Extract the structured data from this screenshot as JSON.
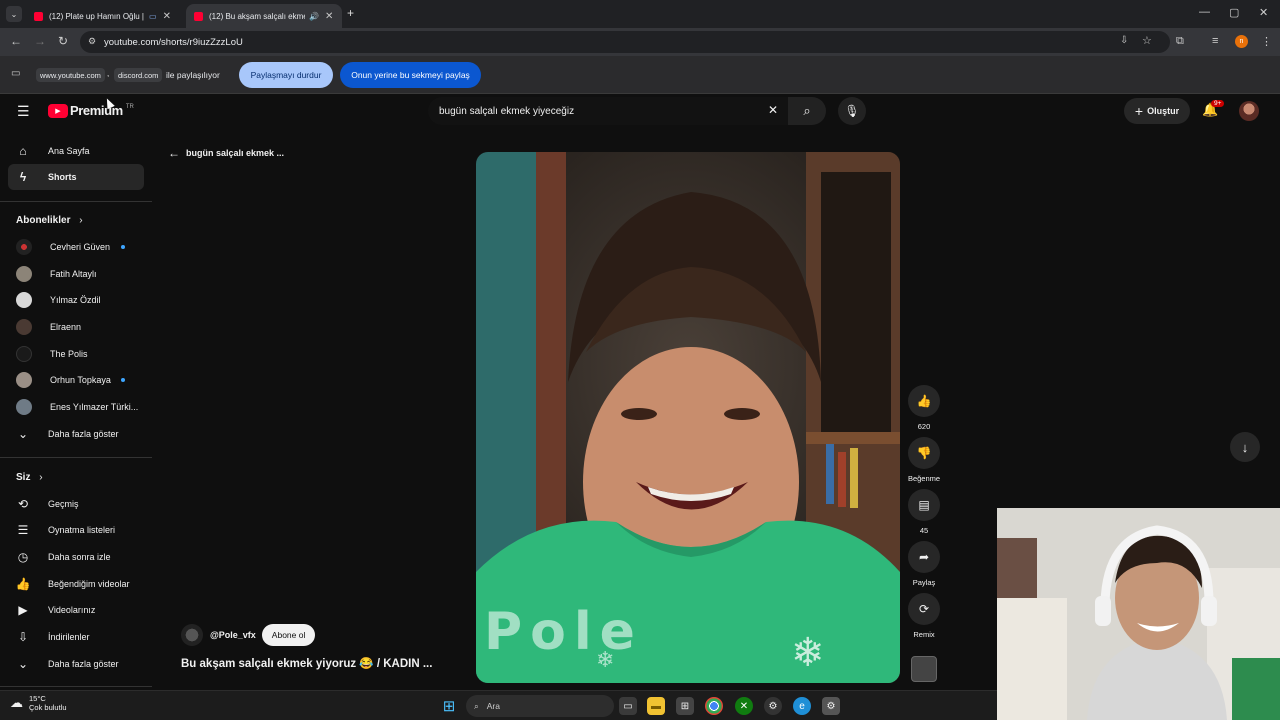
{
  "browser": {
    "tabs": [
      {
        "title": "(12) Plate up Hamın Oğlu |",
        "active": false
      },
      {
        "title": "(12) Bu akşam salçalı ekmek",
        "active": true
      }
    ],
    "url": "youtube.com/shorts/r9iuzZzzLoU",
    "sharing": {
      "domain1": "www.youtube.com",
      "separator": ",",
      "domain2": "discord.com",
      "suffix": "ile paylaşılıyor",
      "stop_label": "Paylaşmayı durdur",
      "share_tab_label": "Onun yerine bu sekmeyi paylaş"
    }
  },
  "header": {
    "logo_text": "Premium",
    "region": "TR",
    "search_value": "bugün salçalı ekmek yiyeceğiz",
    "create_label": "Oluştur",
    "notification_count": "9+"
  },
  "sidebar": {
    "main": [
      {
        "label": "Ana Sayfa",
        "icon": "home-icon"
      },
      {
        "label": "Shorts",
        "icon": "shorts-icon",
        "active": true
      }
    ],
    "subscriptions_title": "Abonelikler",
    "subscriptions": [
      {
        "label": "Cevheri Güven",
        "new": true
      },
      {
        "label": "Fatih Altaylı",
        "new": false
      },
      {
        "label": "Yılmaz Özdil",
        "new": false
      },
      {
        "label": "Elraenn",
        "new": false
      },
      {
        "label": "The Polis",
        "new": false
      },
      {
        "label": "Orhun Topkaya",
        "new": true
      },
      {
        "label": "Enes Yılmazer Türki...",
        "new": false
      }
    ],
    "show_more": "Daha fazla göster",
    "you_title": "Siz",
    "you": [
      {
        "label": "Geçmiş",
        "icon": "history-icon"
      },
      {
        "label": "Oynatma listeleri",
        "icon": "playlist-icon"
      },
      {
        "label": "Daha sonra izle",
        "icon": "clock-icon"
      },
      {
        "label": "Beğendiğim videolar",
        "icon": "thumbs-up-icon"
      },
      {
        "label": "Videolarınız",
        "icon": "video-icon"
      },
      {
        "label": "İndirilenler",
        "icon": "download-icon"
      }
    ],
    "show_more_2": "Daha fazla göster"
  },
  "shorts": {
    "back_label": "bugün salçalı ekmek ...",
    "channel": "@Pole_vfx",
    "subscribe_label": "Abone ol",
    "title": "Bu akşam salçalı ekmek yiyoruz 😂 / KADIN ...",
    "watermark": "Pole",
    "actions": {
      "like_count": "620",
      "dislike_label": "Beğenme",
      "comment_count": "45",
      "share_label": "Paylaş",
      "remix_label": "Remix"
    }
  },
  "taskbar": {
    "temperature": "15°C",
    "weather": "Çok bulutlu",
    "search_placeholder": "Ara"
  },
  "colors": {
    "yt_red": "#ff0033",
    "accent_blue": "#3ea6ff",
    "share_stop_bg": "#a8c7fa",
    "share_tab_bg": "#0b57d0"
  }
}
